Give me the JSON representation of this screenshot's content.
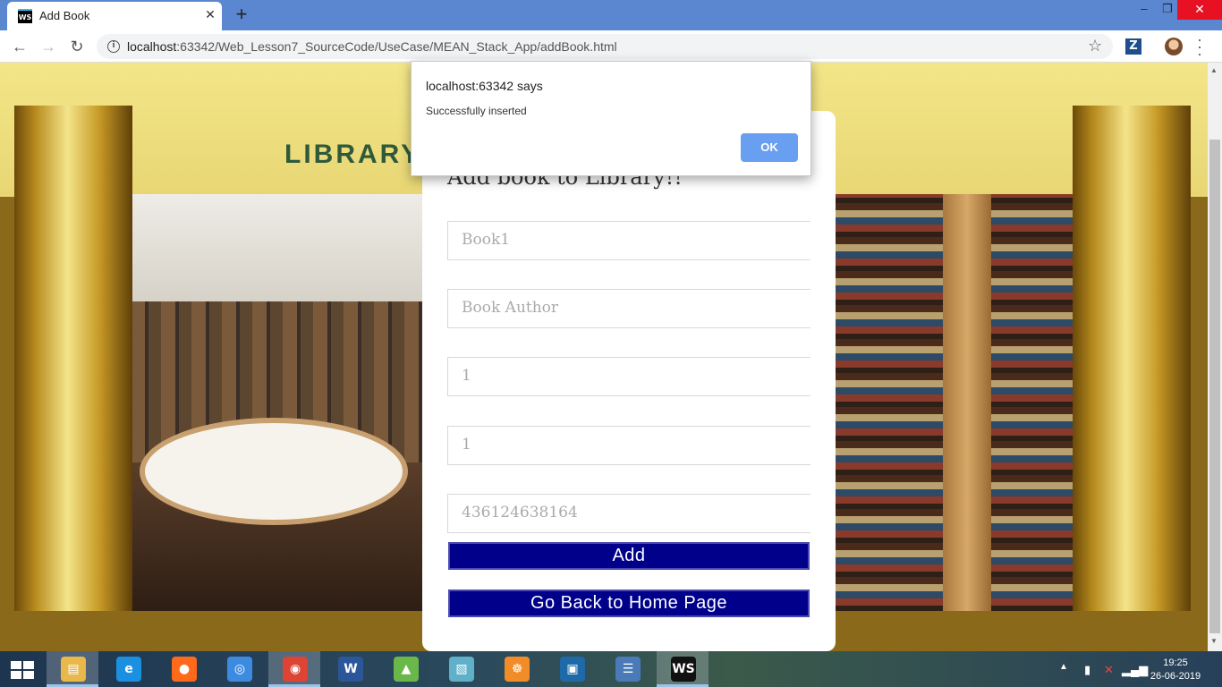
{
  "browser": {
    "tab_title": "Add Book",
    "tab_favicon": "WS",
    "url_host": "localhost",
    "url_rest": ":63342/Web_Lesson7_SourceCode/UseCase/MEAN_Stack_App/addBook.html"
  },
  "page": {
    "banner_title": "LIBRARY MANAGEMENT SYSTEM",
    "form_title": "Add book to Library!!",
    "fields": {
      "book_name": "Book1",
      "book_author_placeholder": "Book Author",
      "field3": "1",
      "field4": "1",
      "field5": "436124638164"
    },
    "add_button": "Add",
    "home_button": "Go Back to Home Page"
  },
  "alert": {
    "title": "localhost:63342 says",
    "message": "Successfully inserted",
    "ok_label": "OK"
  },
  "taskbar": {
    "apps": [
      {
        "name": "file-explorer",
        "glyph": "▤",
        "color": "#e8b84a"
      },
      {
        "name": "internet-explorer",
        "glyph": "e",
        "color": "#1b8fe0"
      },
      {
        "name": "firefox",
        "glyph": "●",
        "color": "#ff6a1a"
      },
      {
        "name": "app-blue",
        "glyph": "◎",
        "color": "#3d8be0"
      },
      {
        "name": "chrome",
        "glyph": "◉",
        "color": "#dd4433"
      },
      {
        "name": "word",
        "glyph": "W",
        "color": "#2b579a"
      },
      {
        "name": "android-studio",
        "glyph": "▲",
        "color": "#6bb84a"
      },
      {
        "name": "app-notes",
        "glyph": "▧",
        "color": "#5fb0c8"
      },
      {
        "name": "app-orange",
        "glyph": "☸",
        "color": "#f28c28"
      },
      {
        "name": "app-frame",
        "glyph": "▣",
        "color": "#1e6aa8"
      },
      {
        "name": "network-app",
        "glyph": "☰",
        "color": "#4a7ab8"
      },
      {
        "name": "webstorm",
        "glyph": "WS",
        "color": "#111111"
      }
    ],
    "clock_time": "19:25",
    "clock_date": "26-06-2019"
  }
}
